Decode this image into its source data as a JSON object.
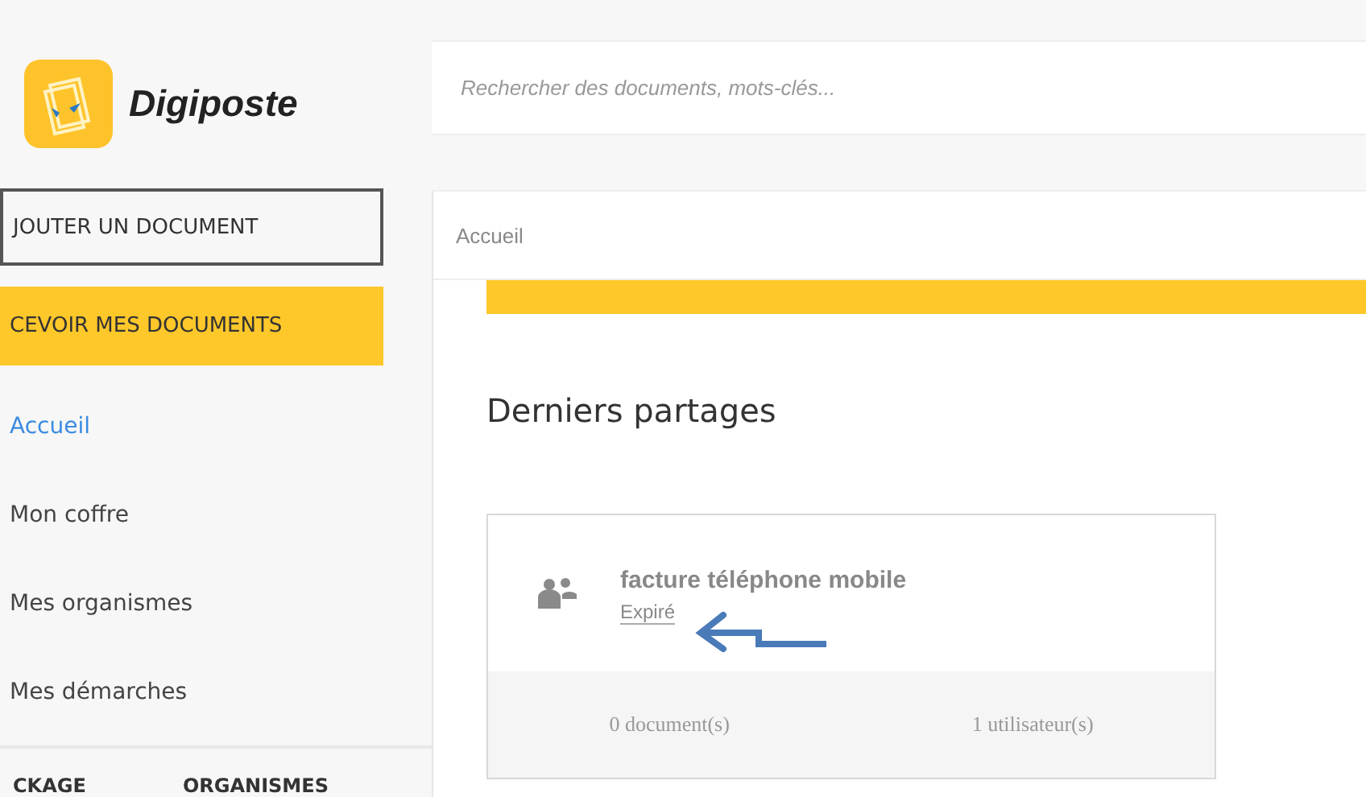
{
  "logo": {
    "name": "Digiposte"
  },
  "sidebar": {
    "buttons": [
      {
        "label": "JOUTER UN DOCUMENT",
        "kind": "outline"
      },
      {
        "label": "CEVOIR MES DOCUMENTS",
        "kind": "primary"
      }
    ],
    "nav": [
      {
        "label": "Accueil",
        "selected": true
      },
      {
        "label": "Mon coffre",
        "selected": false
      },
      {
        "label": "Mes organismes",
        "selected": false
      },
      {
        "label": "Mes démarches",
        "selected": false
      }
    ],
    "bottom_tabs": [
      "CKAGE",
      "ORGANISMES"
    ]
  },
  "search": {
    "placeholder": "Rechercher des documents, mots-clés..."
  },
  "breadcrumb": "Accueil",
  "section_title": "Derniers partages",
  "shares": [
    {
      "title": "facture téléphone mobile",
      "status": "Expiré",
      "documents": "0 document(s)",
      "users": "1 utilisateur(s)"
    }
  ]
}
